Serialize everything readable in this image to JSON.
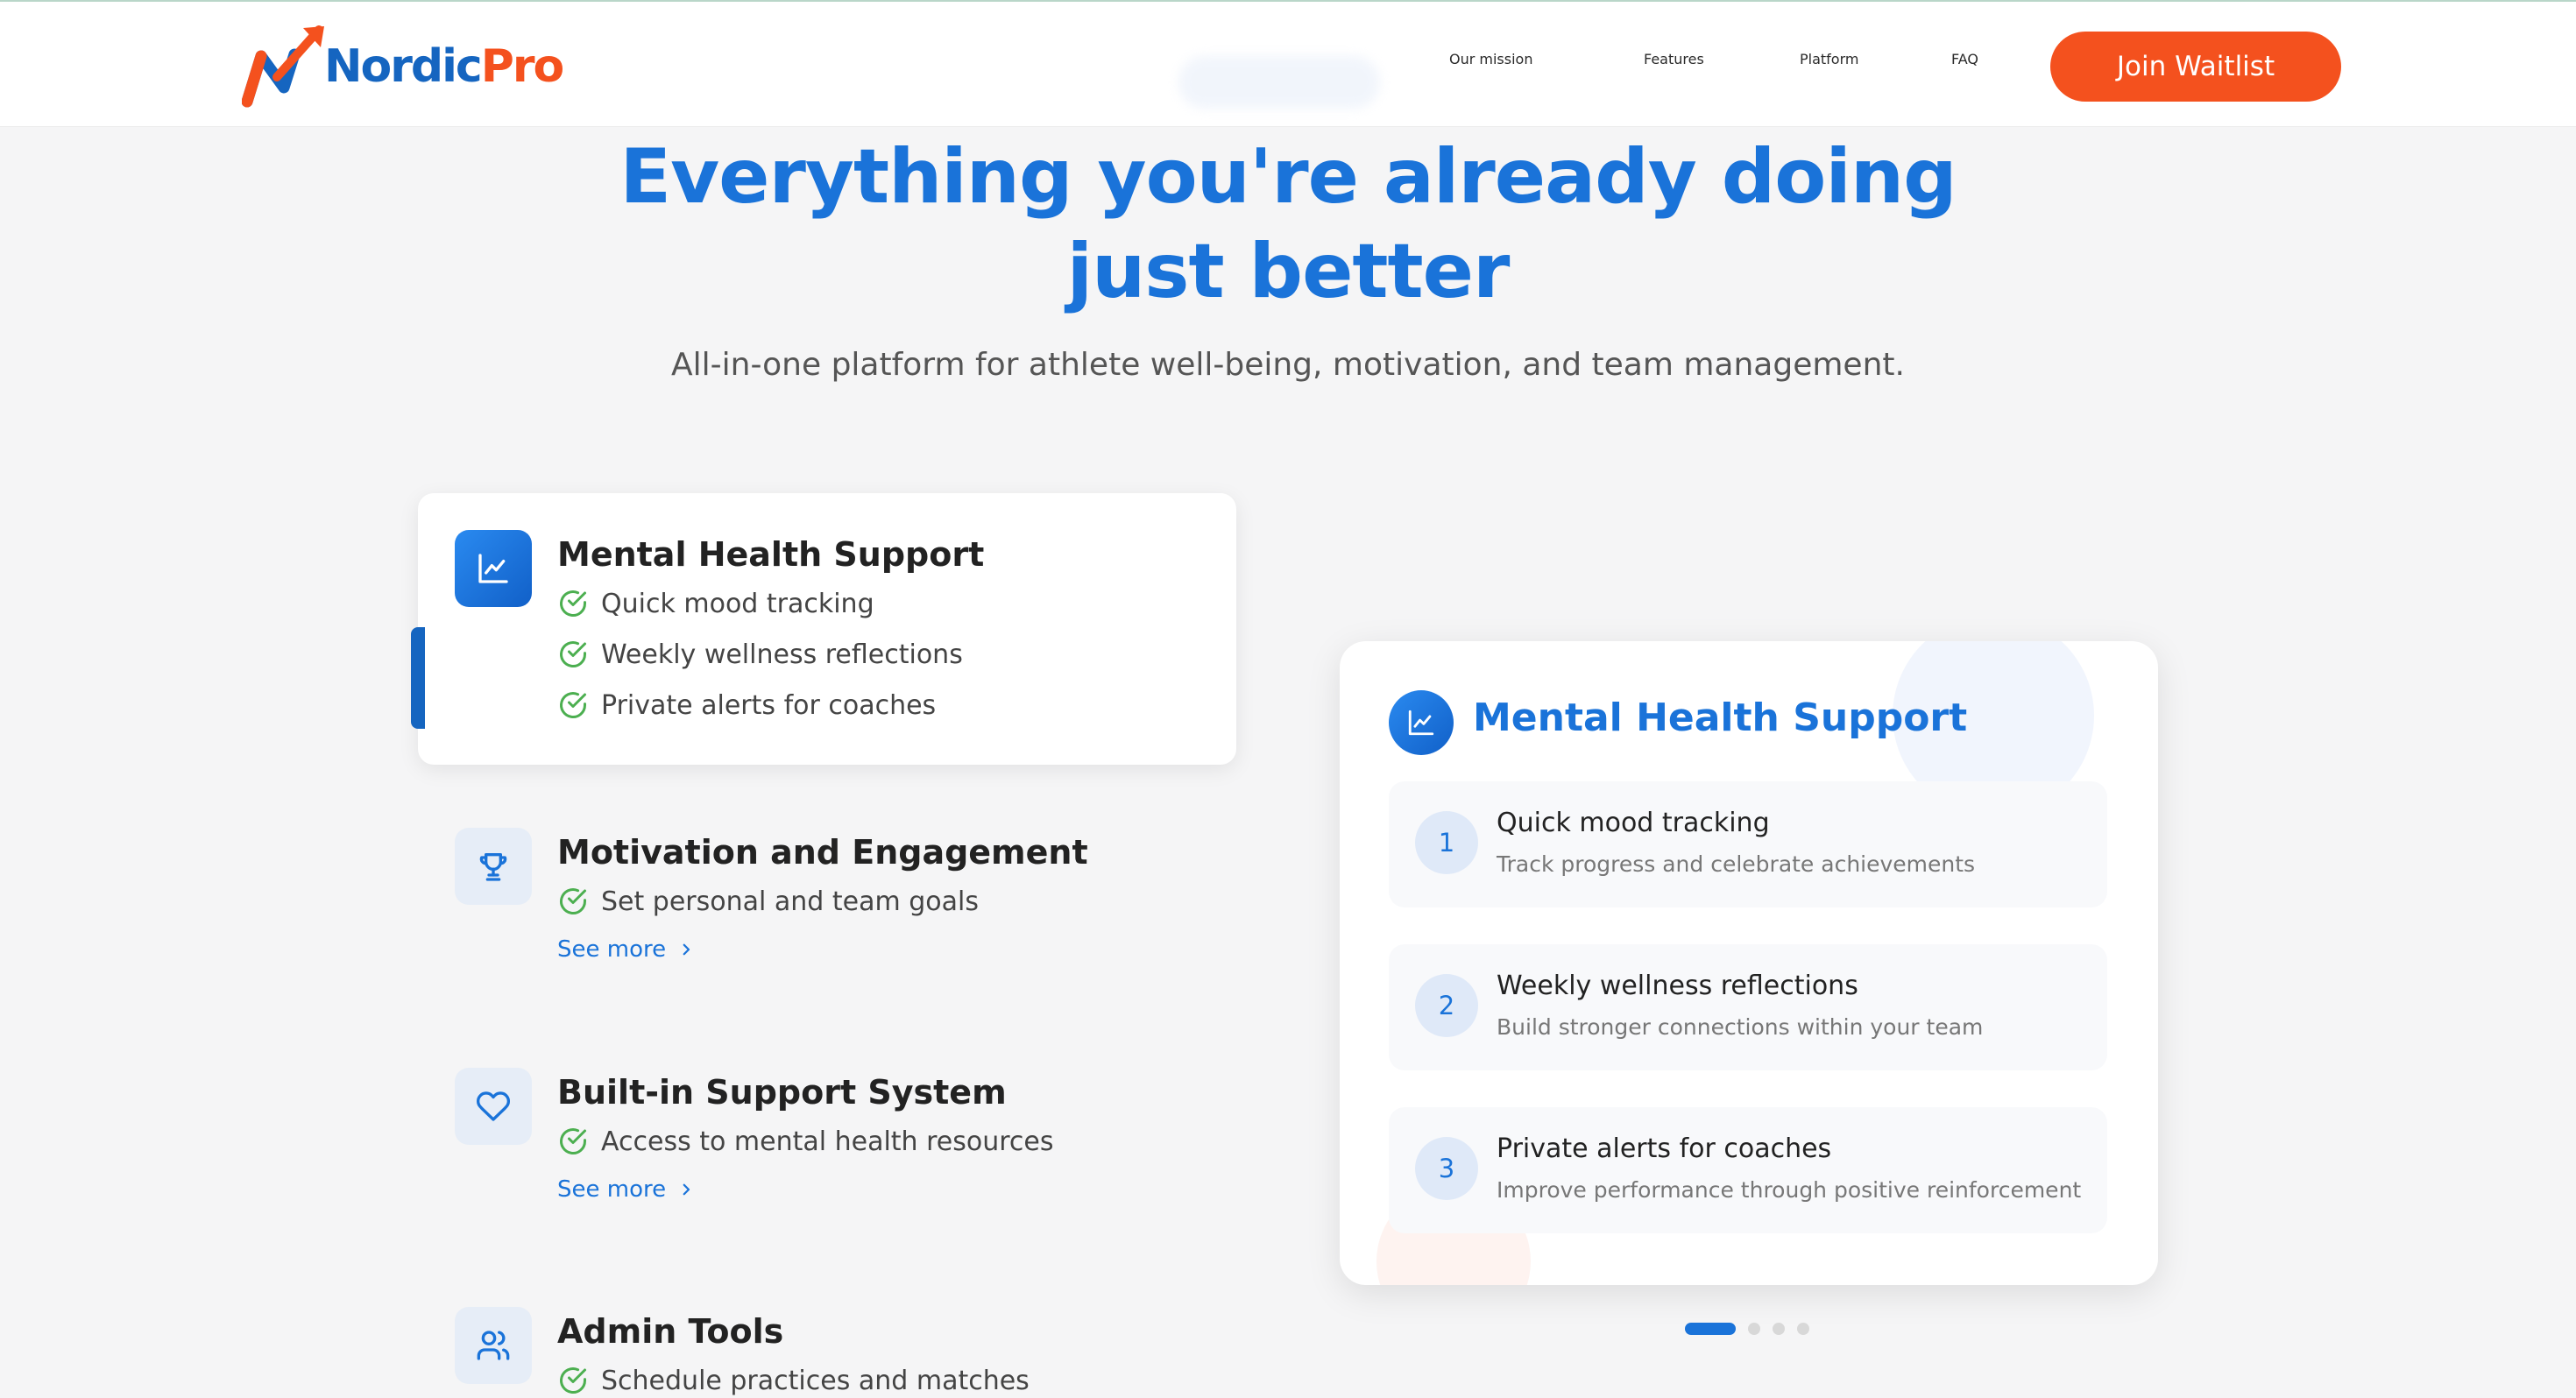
{
  "header": {
    "logo": {
      "text_nordic": "Nordic",
      "text_pro": "Pro"
    },
    "nav": [
      {
        "label": "Our mission"
      },
      {
        "label": "Features"
      },
      {
        "label": "Platform"
      },
      {
        "label": "FAQ"
      }
    ],
    "cta_label": "Join Waitlist"
  },
  "hero": {
    "title_line1": "Everything you're already doing",
    "title_line2": "just better",
    "subtitle": "All-in-one platform for athlete well-being, motivation, and team management."
  },
  "features": [
    {
      "title": "Mental Health Support",
      "icon": "chart-icon",
      "active": true,
      "items": [
        "Quick mood tracking",
        "Weekly wellness reflections",
        "Private alerts for coaches"
      ]
    },
    {
      "title": "Motivation and Engagement",
      "icon": "trophy-icon",
      "items": [
        "Set personal and team goals"
      ],
      "see_more": "See more"
    },
    {
      "title": "Built-in Support System",
      "icon": "heart-icon",
      "items": [
        "Access to mental health resources"
      ],
      "see_more": "See more"
    },
    {
      "title": "Admin Tools",
      "icon": "users-icon",
      "items": [
        "Schedule practices and matches"
      ]
    }
  ],
  "detail_panel": {
    "title": "Mental Health Support",
    "icon": "chart-icon",
    "steps": [
      {
        "num": "1",
        "title": "Quick mood tracking",
        "desc": "Track progress and celebrate achievements"
      },
      {
        "num": "2",
        "title": "Weekly wellness reflections",
        "desc": "Build stronger connections within your team"
      },
      {
        "num": "3",
        "title": "Private alerts for coaches",
        "desc": "Improve performance through positive reinforcement"
      }
    ]
  },
  "carousel": {
    "count": 4,
    "active_index": 0
  },
  "colors": {
    "brand_blue": "#1a73d9",
    "brand_orange": "#f4511e",
    "check_green": "#4caf50",
    "background": "#f5f5f6"
  }
}
